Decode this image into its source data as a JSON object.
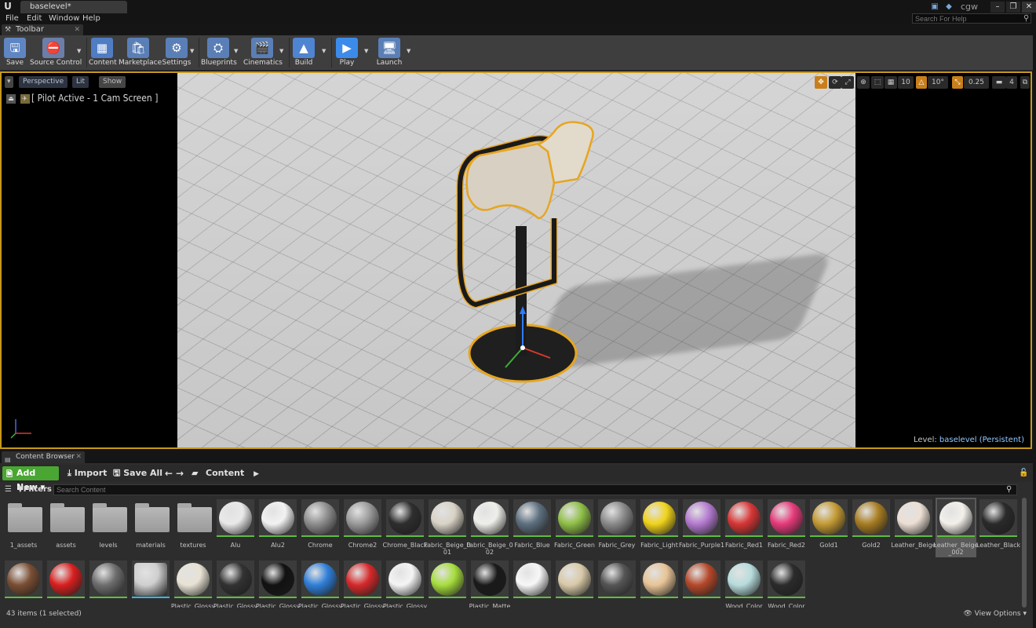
{
  "titlebar": {
    "logo": "U",
    "document_tab": "baselevel*",
    "user": "cgw",
    "help_search_placeholder": "Search For Help"
  },
  "menu": [
    "File",
    "Edit",
    "Window",
    "Help"
  ],
  "toolbar_tab": {
    "label": "Toolbar"
  },
  "toolbar": [
    {
      "label": "Save",
      "icon": "save-icon",
      "color": "#5f86c2"
    },
    {
      "label": "Source Control",
      "icon": "source-control-icon",
      "color": "#6c7ea8"
    },
    {
      "label": "Content",
      "icon": "content-icon",
      "color": "#4f7cc3"
    },
    {
      "label": "Marketplace",
      "icon": "marketplace-icon",
      "color": "#5a7fb6"
    },
    {
      "label": "Settings",
      "icon": "settings-icon",
      "color": "#5a7fb6"
    },
    {
      "label": "Blueprints",
      "icon": "blueprints-icon",
      "color": "#5a7fb6"
    },
    {
      "label": "Cinematics",
      "icon": "cinematics-icon",
      "color": "#5a7fb6"
    },
    {
      "label": "Build",
      "icon": "build-icon",
      "color": "#4f84d0"
    },
    {
      "label": "Play",
      "icon": "play-icon",
      "color": "#3c8bea"
    },
    {
      "label": "Launch",
      "icon": "launch-icon",
      "color": "#5a7fb6"
    }
  ],
  "viewport": {
    "perspective": "Perspective",
    "lit": "Lit",
    "show": "Show",
    "pilot_text": "[ Pilot Active - 1 Cam Screen ]",
    "grid_snap": "10",
    "rotation_snap": "10°",
    "scale_snap": "0.25",
    "camera_speed": "4",
    "level_label": "Level:",
    "level_value": "baselevel (Persistent)",
    "border_color": "#c6981d"
  },
  "content_browser": {
    "tab_label": "Content Browser",
    "add_new": "Add New",
    "import": "Import",
    "save_all": "Save All",
    "path": "Content",
    "filters": "Filters",
    "search_placeholder": "Search Content",
    "status": "43 items (1 selected)",
    "view_options": "View Options",
    "assets_row1": [
      {
        "label": "1_assets",
        "type": "folder"
      },
      {
        "label": "assets",
        "type": "folder"
      },
      {
        "label": "levels",
        "type": "folder"
      },
      {
        "label": "materials",
        "type": "folder"
      },
      {
        "label": "textures",
        "type": "folder"
      },
      {
        "label": "Alu",
        "type": "material",
        "color": "#e9e9e9"
      },
      {
        "label": "Alu2",
        "type": "material",
        "color": "#f2f2f2"
      },
      {
        "label": "Chrome",
        "type": "material",
        "color": "#8e8e8e"
      },
      {
        "label": "Chrome2",
        "type": "material",
        "color": "#9a9a9a"
      },
      {
        "label": "Chrome_Black",
        "type": "material",
        "color": "#2e2e2e"
      },
      {
        "label": "Fabric_Beige_001",
        "type": "material",
        "color": "#d9d3c6"
      },
      {
        "label": "Fabric_Beige_002",
        "type": "material",
        "color": "#eeeeea"
      },
      {
        "label": "Fabric_Blue",
        "type": "material",
        "color": "#5e7080"
      },
      {
        "label": "Fabric_Green",
        "type": "material",
        "color": "#8fbf47"
      },
      {
        "label": "Fabric_Grey",
        "type": "material",
        "color": "#8a8a8a"
      },
      {
        "label": "Fabric_Light",
        "type": "material",
        "color": "#f0d31a"
      },
      {
        "label": "Fabric_Purple1",
        "type": "material",
        "color": "#b47ad0"
      },
      {
        "label": "Fabric_Red1",
        "type": "material",
        "color": "#d83636"
      },
      {
        "label": "Fabric_Red2",
        "type": "material",
        "color": "#e63a7a"
      },
      {
        "label": "Gold1",
        "type": "material",
        "color": "#c49a33"
      },
      {
        "label": "Gold2",
        "type": "material",
        "color": "#a87d22"
      },
      {
        "label": "Leather_Beige",
        "type": "material",
        "color": "#ecdfd4"
      },
      {
        "label": "Leather_Beige_002",
        "type": "material",
        "color": "#f3f0ea",
        "selected": true
      },
      {
        "label": "Leather_Black",
        "type": "material",
        "color": "#2a2a2a"
      }
    ],
    "assets_row2": [
      {
        "label": "",
        "type": "material",
        "color": "#7a4e33"
      },
      {
        "label": "",
        "type": "material",
        "color": "#d91f1f"
      },
      {
        "label": "",
        "type": "material",
        "color": "#6e6e6e"
      },
      {
        "label": "",
        "type": "mesh",
        "color": "#cfcfcf"
      },
      {
        "label": "Plastic_Glossy",
        "type": "material",
        "color": "#e8e2d4"
      },
      {
        "label": "Plastic_Glossy",
        "type": "material",
        "color": "#323232"
      },
      {
        "label": "Plastic_Glossy",
        "type": "material",
        "color": "#111111"
      },
      {
        "label": "Plastic_Glossy",
        "type": "material",
        "color": "#2f7fd8"
      },
      {
        "label": "Plastic_Glossy",
        "type": "material",
        "color": "#d6292b"
      },
      {
        "label": "Plastic_Glossy",
        "type": "material",
        "color": "#f4f4f4"
      },
      {
        "label": "",
        "type": "material",
        "color": "#a6dd3c"
      },
      {
        "label": "Plastic_Matte",
        "type": "material",
        "color": "#1a1a1a"
      },
      {
        "label": "",
        "type": "material",
        "color": "#f7f7f7"
      },
      {
        "label": "",
        "type": "material",
        "color": "#d8c9a8"
      },
      {
        "label": "",
        "type": "material",
        "color": "#555555"
      },
      {
        "label": "",
        "type": "material",
        "color": "#e7c496"
      },
      {
        "label": "",
        "type": "material",
        "color": "#b5482a"
      },
      {
        "label": "Wood_Color",
        "type": "material",
        "color": "#b7dcdc"
      },
      {
        "label": "Wood_Color",
        "type": "material",
        "color": "#2b2b2b"
      }
    ]
  }
}
